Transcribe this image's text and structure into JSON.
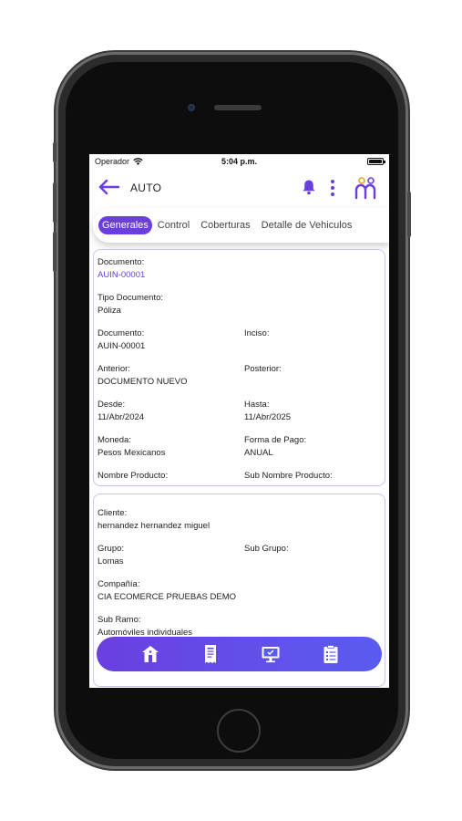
{
  "status_bar": {
    "carrier": "Operador",
    "time": "5:04 p.m."
  },
  "header": {
    "title": "AUTO"
  },
  "tabs": [
    {
      "label": "Generales",
      "active": true
    },
    {
      "label": "Control",
      "active": false
    },
    {
      "label": "Coberturas",
      "active": false
    },
    {
      "label": "Detalle de Vehiculos",
      "active": false
    }
  ],
  "card1": {
    "documento_top": {
      "label": "Documento:",
      "value": "AUIN-00001"
    },
    "tipo_documento": {
      "label": "Tipo Documento:",
      "value": "Póliza"
    },
    "documento": {
      "label": "Documento:",
      "value": "AUIN-00001"
    },
    "inciso": {
      "label": "Inciso:",
      "value": ""
    },
    "anterior": {
      "label": "Anterior:",
      "value": "DOCUMENTO NUEVO"
    },
    "posterior": {
      "label": "Posterior:",
      "value": ""
    },
    "desde": {
      "label": "Desde:",
      "value": "11/Abr/2024"
    },
    "hasta": {
      "label": "Hasta:",
      "value": "11/Abr/2025"
    },
    "moneda": {
      "label": "Moneda:",
      "value": "Pesos Mexicanos"
    },
    "forma_pago": {
      "label": "Forma de Pago:",
      "value": "ANUAL"
    },
    "nombre_producto": {
      "label": "Nombre Producto:",
      "value": ""
    },
    "sub_nombre_producto": {
      "label": "Sub Nombre Producto:",
      "value": ""
    }
  },
  "card2": {
    "cliente": {
      "label": "Cliente:",
      "value": "hernandez hernandez miguel"
    },
    "grupo": {
      "label": "Grupo:",
      "value": "Lomas"
    },
    "sub_grupo": {
      "label": "Sub Grupo:",
      "value": ""
    },
    "compania": {
      "label": "Compañía:",
      "value": "CIA ECOMERCE PRUEBAS DEMO"
    },
    "sub_ramo": {
      "label": "Sub Ramo:",
      "value": "Automóviles individuales"
    }
  },
  "bottom_nav": [
    {
      "icon": "home-icon"
    },
    {
      "icon": "receipt-icon"
    },
    {
      "icon": "monitor-icon"
    },
    {
      "icon": "clipboard-icon"
    }
  ],
  "colors": {
    "accent": "#6a3ee0",
    "card_border": "#c9c3ef",
    "logo_orange": "#f4a028"
  }
}
